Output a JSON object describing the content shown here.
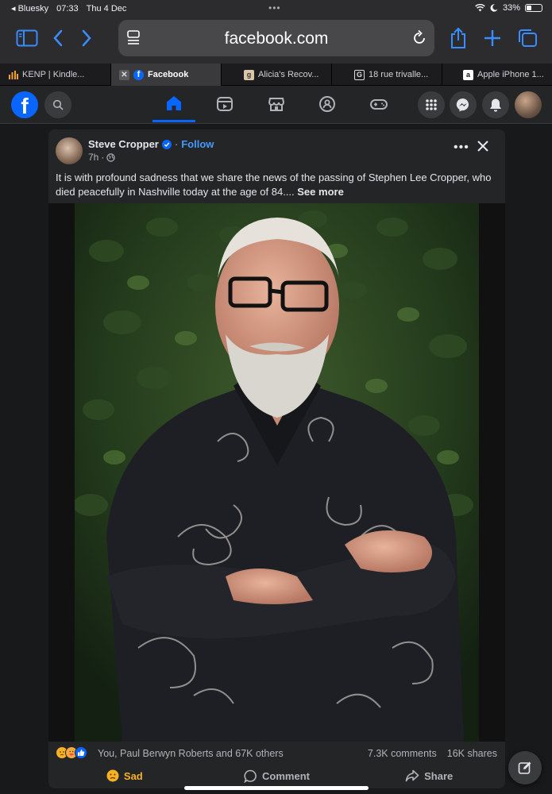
{
  "status": {
    "back_app": "Bluesky",
    "time": "07:33",
    "date": "Thu 4 Dec",
    "battery": "33%",
    "battery_level": 0.33
  },
  "browser": {
    "url": "facebook.com",
    "accent": "#3a8dff"
  },
  "tabs": [
    {
      "label": "KENP | Kindle...",
      "icon": "bar-chart-icon",
      "active": false
    },
    {
      "label": "Facebook",
      "icon": "facebook-icon",
      "active": true
    },
    {
      "label": "Alicia's Recov...",
      "icon": "g-letter-icon",
      "active": false
    },
    {
      "label": "18 rue trivalle...",
      "icon": "g-letter-icon",
      "active": false
    },
    {
      "label": "Apple iPhone 1...",
      "icon": "amazon-icon",
      "active": false
    }
  ],
  "fb": {
    "brand_color": "#0866ff"
  },
  "post": {
    "author": "Steve Cropper",
    "follow_label": "Follow",
    "separator": "·",
    "time": "7h",
    "text": "It is with profound sadness that we share the news of the passing of Stephen Lee Cropper, who died peacefully in Nashville today at the age of 84....",
    "see_more": "See more",
    "reacters": "You, Paul Berwyn Roberts and 67K others",
    "comments": "7.3K comments",
    "shares": "16K shares",
    "actions": {
      "react": "Sad",
      "comment": "Comment",
      "share": "Share"
    }
  }
}
